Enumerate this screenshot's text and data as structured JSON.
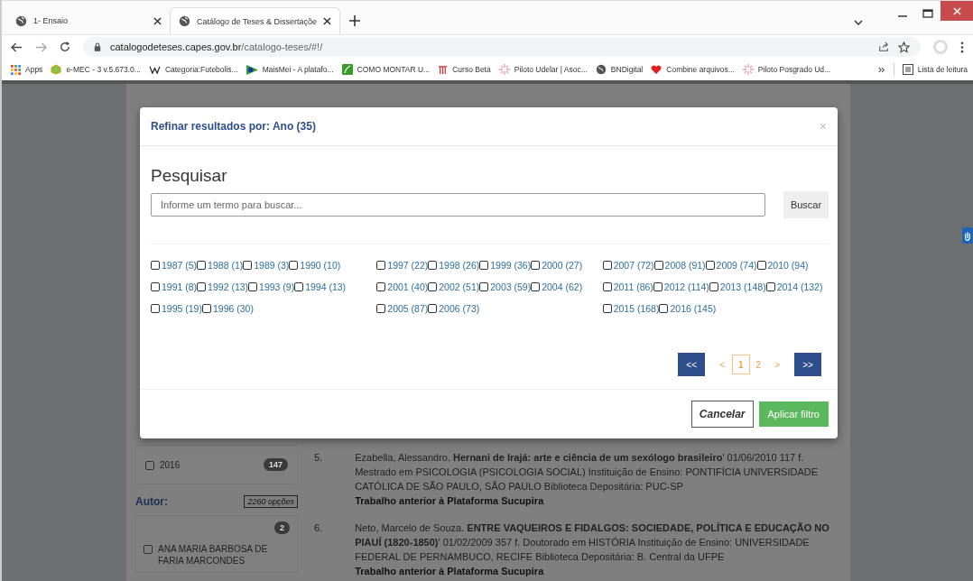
{
  "browser": {
    "tabs": [
      {
        "title": "1- Ensaio",
        "selected": false
      },
      {
        "title": "Catálogo de Teses & Dissertaçõe",
        "selected": true
      }
    ],
    "address": {
      "domain": "catalogodeteses.capes.gov.br",
      "path": "/catalogo-teses/#!/"
    },
    "bookmarks": [
      {
        "label": "Apps",
        "kind": "apps"
      },
      {
        "label": "e-MEC - 3 v.5.673.0...",
        "kind": "emec"
      },
      {
        "label": "Categoria:Futebolis...",
        "kind": "wiki"
      },
      {
        "label": "MaisMei - A platafo...",
        "kind": "flag"
      },
      {
        "label": "COMO MONTAR U...",
        "kind": "green"
      },
      {
        "label": "Curso Beta",
        "kind": "columns"
      },
      {
        "label": "Piloto Udelar | Asoc...",
        "kind": "star"
      },
      {
        "label": "BNDigital",
        "kind": "globe"
      },
      {
        "label": "Combine arquivos...",
        "kind": "heart"
      },
      {
        "label": "Piloto Posgrado Ud...",
        "kind": "star"
      }
    ],
    "reading_list": "Lista de leitura"
  },
  "sidebar": {
    "year_item": {
      "label": "2016",
      "count": "147",
      "checked": false
    },
    "author_heading": "Autor:",
    "author_options": "2260 opções",
    "author_item": {
      "label": "ANA MARIA BARBOSA DE FARIA MARCONDES",
      "count": "2",
      "checked": false
    }
  },
  "results": [
    {
      "number": "5.",
      "text": "Ezabella, Alessandro. **Hernani de Irajá: arte e ciência de um sexólogo brasileiro**' 01/06/2010 117 f. Mestrado em PSICOLOGIA (PSICOLOGIA SOCIAL) Instituição de Ensino: PONTIFÍCIA UNIVERSIDADE CATÓLICA DE SÃO PAULO, SÃO PAULO Biblioteca Depositária: PUC-SP",
      "note": "Trabalho anterior à Plataforma Sucupira"
    },
    {
      "number": "6.",
      "text": "Neto, Marcelo de Souza. **ENTRE VAQUEIROS E FIDALGOS: SOCIEDADE, POLÍTICA E EDUCAÇÃO NO PIAUÍ (1820-1850)**' 01/02/2009 357 f. Doutorado em HISTÓRIA Instituição de Ensino: UNIVERSIDADE FEDERAL DE PERNAMBUCO, RECIFE Biblioteca Depositária: B. Central da UFPE",
      "note": "Trabalho anterior à Plataforma Sucupira"
    }
  ],
  "modal": {
    "title": "Refinar resultados por: Ano (35)",
    "close": "×",
    "search_heading": "Pesquisar",
    "search": {
      "placeholder": "Informe um termo para buscar..."
    },
    "search_button": "Buscar",
    "columns": [
      [
        [
          {
            "label": "1987 (5)",
            "checked": false
          },
          {
            "label": "1988 (1)",
            "checked": false
          },
          {
            "label": "1989 (3)",
            "checked": false
          },
          {
            "label": "1990 (10)",
            "checked": false
          }
        ],
        [
          {
            "label": "1991 (8)",
            "checked": false
          },
          {
            "label": "1992 (13)",
            "checked": false
          },
          {
            "label": "1993 (9)",
            "checked": false
          },
          {
            "label": "1994 (13)",
            "checked": false
          }
        ],
        [
          {
            "label": "1995 (19)",
            "checked": false
          },
          {
            "label": "1996 (30)",
            "checked": false
          }
        ]
      ],
      [
        [
          {
            "label": "1997 (22)",
            "checked": false
          },
          {
            "label": "1998 (26)",
            "checked": false
          },
          {
            "label": "1999 (36)",
            "checked": false
          },
          {
            "label": "2000 (27)",
            "checked": false
          }
        ],
        [
          {
            "label": "2001 (40)",
            "checked": false
          },
          {
            "label": "2002 (51)",
            "checked": false
          },
          {
            "label": "2003 (59)",
            "checked": false
          },
          {
            "label": "2004 (62)",
            "checked": false
          }
        ],
        [
          {
            "label": "2005 (87)",
            "checked": false
          },
          {
            "label": "2006 (73)",
            "checked": false
          }
        ]
      ],
      [
        [
          {
            "label": "2007 (72)",
            "checked": false
          },
          {
            "label": "2008 (91)",
            "checked": false
          },
          {
            "label": "2009 (74)",
            "checked": false
          },
          {
            "label": "2010 (94)",
            "checked": false
          }
        ],
        [
          {
            "label": "2011 (86)",
            "checked": false
          },
          {
            "label": "2012 (114)",
            "checked": false
          },
          {
            "label": "2013 (148)",
            "checked": false
          },
          {
            "label": "2014 (132)",
            "checked": false
          }
        ],
        [
          {
            "label": "2015 (168)",
            "checked": false
          },
          {
            "label": "2016 (145)",
            "checked": false
          }
        ]
      ]
    ],
    "pagination": [
      {
        "label": "<<",
        "kind": "block"
      },
      {
        "label": "<",
        "kind": "arrow"
      },
      {
        "label": "1",
        "kind": "page",
        "selected": true
      },
      {
        "label": "2",
        "kind": "page",
        "selected": false
      },
      {
        "label": ">",
        "kind": "arrow"
      },
      {
        "label": ">>",
        "kind": "block"
      }
    ],
    "cancel_button": "Cancelar",
    "apply_button": "Aplicar filtro"
  }
}
